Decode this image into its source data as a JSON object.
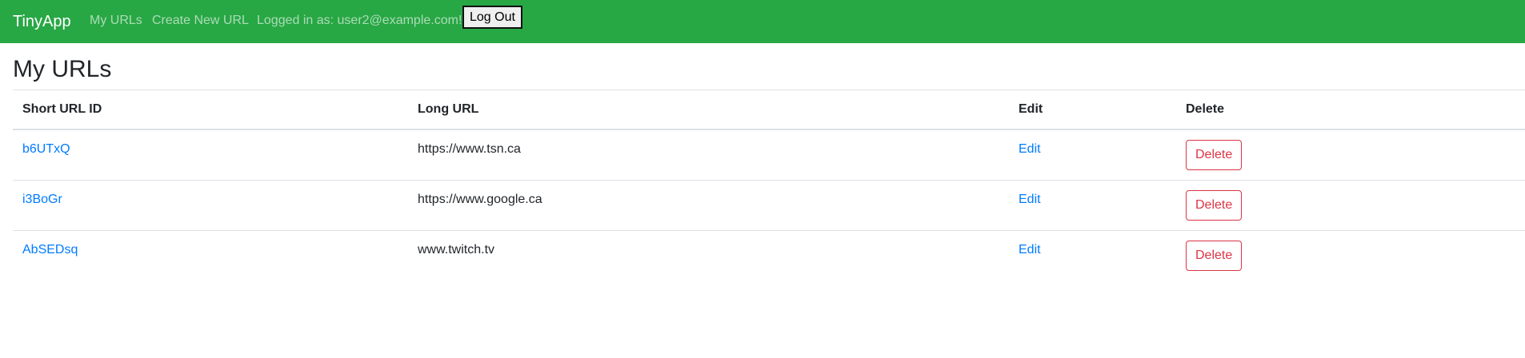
{
  "navbar": {
    "brand": "TinyApp",
    "links": {
      "my_urls": "My URLs",
      "create_new": "Create New URL"
    },
    "login_text": "Logged in as: user2@example.com!",
    "logout_label": "Log Out",
    "bg_color": "#28a745"
  },
  "page": {
    "title": "My URLs"
  },
  "table": {
    "headers": {
      "short_id": "Short URL ID",
      "long_url": "Long URL",
      "edit": "Edit",
      "delete": "Delete"
    },
    "rows": [
      {
        "short_id": "b6UTxQ",
        "long_url": "https://www.tsn.ca",
        "edit": "Edit",
        "delete": "Delete"
      },
      {
        "short_id": "i3BoGr",
        "long_url": "https://www.google.ca",
        "edit": "Edit",
        "delete": "Delete"
      },
      {
        "short_id": "AbSEDsq",
        "long_url": "www.twitch.tv",
        "edit": "Edit",
        "delete": "Delete"
      }
    ]
  },
  "colors": {
    "link": "#007bff",
    "danger": "#dc3545"
  }
}
